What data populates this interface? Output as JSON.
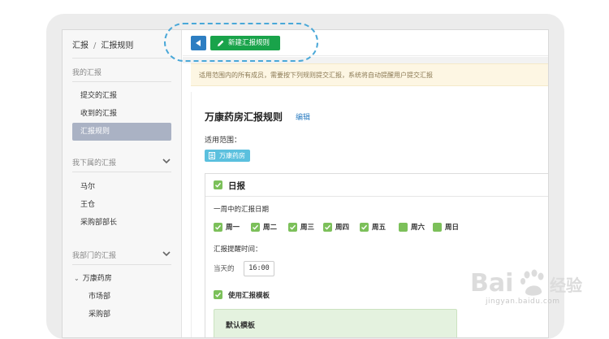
{
  "breadcrumb": {
    "root": "汇报",
    "separator": "/",
    "current": "汇报规则"
  },
  "sidebar": {
    "section_mine": "我的汇报",
    "mine_items": [
      {
        "label": "提交的汇报"
      },
      {
        "label": "收到的汇报"
      },
      {
        "label": "汇报规则",
        "active": true
      }
    ],
    "section_subordinates": "我下属的汇报",
    "subordinate_items": [
      {
        "label": "马尔"
      },
      {
        "label": "王仓"
      },
      {
        "label": "采购部部长"
      }
    ],
    "section_department": "我部门的汇报",
    "department_tree": {
      "root": "万康药房",
      "children": [
        {
          "label": "市场部"
        },
        {
          "label": "采购部"
        }
      ]
    }
  },
  "toolbar": {
    "new_rule_label": "新建汇报规则"
  },
  "notice": {
    "text": "适用范围内的所有成员，需要按下列规则提交汇报，系统将自动提醒用户提交汇报"
  },
  "rule": {
    "title": "万康药房汇报规则",
    "edit_label": "编辑",
    "scope_label": "适用范围：",
    "scope_chip": "万康药房",
    "daily": {
      "title": "日报",
      "days_label": "一周中的汇报日期",
      "days": [
        {
          "label": "周一",
          "checked": true
        },
        {
          "label": "周二",
          "checked": true
        },
        {
          "label": "周三",
          "checked": true
        },
        {
          "label": "周四",
          "checked": true
        },
        {
          "label": "周五",
          "checked": true
        },
        {
          "label": "周六",
          "checked": false
        },
        {
          "label": "周日",
          "checked": false
        }
      ],
      "remind_label": "汇报提醒时间：",
      "remind_prefix": "当天的",
      "remind_time": "16:00",
      "use_template_label": "使用汇报模板",
      "template_name": "默认模板"
    }
  },
  "watermark": {
    "brand": "Bai 经验",
    "url": "jingyan.baidu.com"
  },
  "colors": {
    "primary": "#2d7ec2",
    "success": "#19a34a",
    "check": "#7cc05a",
    "chip": "#5bc0de",
    "callout": "#4aa8d8"
  }
}
